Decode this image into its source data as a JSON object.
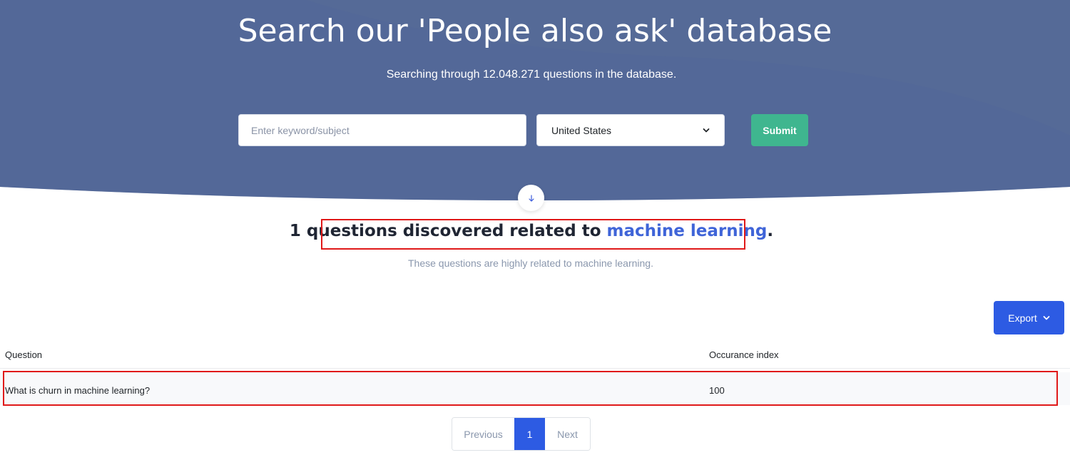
{
  "colors": {
    "hero_bg": "#556a97",
    "submit": "#3fb68f",
    "primary": "#2d5be3",
    "highlight": "#e01919",
    "keyword": "#3f64d8"
  },
  "hero": {
    "title": "Search our 'People also ask' database",
    "subtitle": "Searching through 12.048.271 questions in the database.",
    "search_placeholder": "Enter keyword/subject",
    "search_value": "",
    "country_selected": "United States",
    "submit_label": "Submit",
    "scroll_icon": "arrow-down-icon"
  },
  "results": {
    "title_prefix": "1 questions discovered related to ",
    "keyword": "machine learning",
    "title_suffix": ".",
    "subtitle": "These questions are highly related to machine learning.",
    "export_label": "Export",
    "columns": [
      "Question",
      "Occurance index"
    ],
    "rows": [
      {
        "question": "What is churn in machine learning?",
        "index": "100"
      }
    ]
  },
  "pagination": {
    "previous": "Previous",
    "current": "1",
    "next": "Next"
  }
}
